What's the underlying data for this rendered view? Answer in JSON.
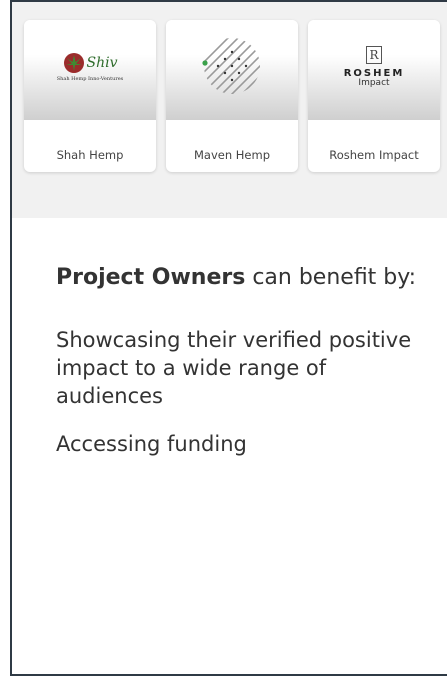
{
  "cards": [
    {
      "name": "Shah Hemp",
      "logo_text": "Shiv",
      "logo_subtext": "Shah Hemp Inno-Ventures"
    },
    {
      "name": "Maven Hemp"
    },
    {
      "name": "Roshem Impact",
      "logo_mark": "R",
      "logo_text": "ROSHEM",
      "logo_subtext": "Impact"
    }
  ],
  "content": {
    "heading_bold": "Project Owners",
    "heading_rest": " can benefit by:",
    "items": [
      "Showcasing their verified positive impact to a wide range of audiences",
      "Accessing funding"
    ]
  },
  "colors": {
    "frame_border": "#2f3a45",
    "band": "#f1f1f1",
    "accent_green": "#2d6b2a"
  }
}
